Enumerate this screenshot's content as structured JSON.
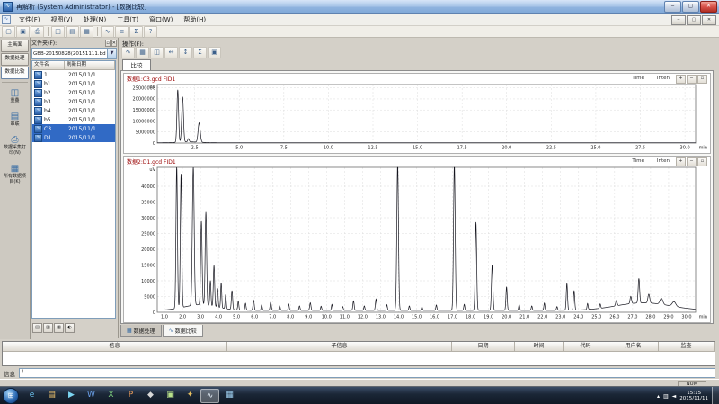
{
  "colors": {
    "selection": "#316ac5",
    "chart_title": "#990000",
    "titlebar": "#a9c6e8",
    "taskbar": "#1b2737"
  },
  "window": {
    "title": "再解析 (System Administrator) - [数据比较]",
    "controls": {
      "minimize": "‒",
      "maximize": "▢",
      "close": "✕"
    }
  },
  "menu": {
    "items": [
      "文件(F)",
      "视图(V)",
      "处理(M)",
      "工具(T)",
      "窗口(W)",
      "帮助(H)"
    ],
    "mdi_controls": [
      "‒",
      "▢",
      "✕"
    ]
  },
  "toolbar": {
    "icons": [
      {
        "name": "open-icon",
        "glyph": "▢"
      },
      {
        "name": "save-icon",
        "glyph": "▣"
      },
      {
        "name": "print-icon",
        "glyph": "⎙"
      },
      {
        "name": "sep",
        "glyph": ""
      },
      {
        "name": "overlay-view-icon",
        "glyph": "◫"
      },
      {
        "name": "tile-view-icon",
        "glyph": "▤"
      },
      {
        "name": "grid-view-icon",
        "glyph": "▦"
      },
      {
        "name": "sep",
        "glyph": ""
      },
      {
        "name": "chromatogram-icon",
        "glyph": "∿"
      },
      {
        "name": "list-icon",
        "glyph": "≡"
      },
      {
        "name": "calc-icon",
        "glyph": "Σ"
      },
      {
        "name": "help-icon",
        "glyph": "?"
      }
    ]
  },
  "sidebar": {
    "tabs": [
      {
        "label": "主画面",
        "active": false
      },
      {
        "label": "数据处理",
        "active": false
      },
      {
        "label": "数据比较",
        "active": true
      }
    ],
    "items": [
      {
        "name": "overlay",
        "label": "重叠",
        "glyph": "◫"
      },
      {
        "name": "series",
        "label": "串联",
        "glyph": "▤"
      },
      {
        "name": "report-print",
        "label": "数据采集打印(N)",
        "glyph": "⎙"
      },
      {
        "name": "all-data-items",
        "label": "所有数据项目(K)",
        "glyph": "▦"
      }
    ]
  },
  "file_panel": {
    "folder_label": "文件夹(F):",
    "folder_value": "GBB-20150828(20151111.bd",
    "header_buttons": [
      {
        "name": "pin-icon",
        "glyph": "▫"
      },
      {
        "name": "close-icon",
        "glyph": "✕"
      }
    ],
    "columns": [
      "文件名",
      "刷新日期"
    ],
    "files": [
      {
        "name": "1",
        "date": "2015/11/1",
        "selected": false
      },
      {
        "name": "b1",
        "date": "2015/11/1",
        "selected": false
      },
      {
        "name": "b2",
        "date": "2015/11/1",
        "selected": false
      },
      {
        "name": "b3",
        "date": "2015/11/1",
        "selected": false
      },
      {
        "name": "b4",
        "date": "2015/11/1",
        "selected": false
      },
      {
        "name": "b5",
        "date": "2015/11/1",
        "selected": false
      },
      {
        "name": "C3",
        "date": "2015/11/1",
        "selected": true
      },
      {
        "name": "D1",
        "date": "2015/11/1",
        "selected": true
      }
    ],
    "footer_icons": [
      {
        "name": "list-view-icon",
        "glyph": "▤"
      },
      {
        "name": "detail-view-icon",
        "glyph": "▥"
      },
      {
        "name": "thumb-view-icon",
        "glyph": "▦"
      },
      {
        "name": "refresh-icon",
        "glyph": "◐"
      }
    ]
  },
  "main": {
    "operation_label": "操作(F):",
    "op_icons": [
      {
        "name": "op-chromatogram-icon",
        "glyph": "∿"
      },
      {
        "name": "op-grid-icon",
        "glyph": "▦"
      },
      {
        "name": "op-overlay-icon",
        "glyph": "◫"
      },
      {
        "name": "op-stretch-x-icon",
        "glyph": "↔"
      },
      {
        "name": "op-stretch-y-icon",
        "glyph": "↕"
      },
      {
        "name": "op-calc-icon",
        "glyph": "Σ"
      },
      {
        "name": "op-save-icon",
        "glyph": "▣"
      }
    ],
    "compare_tab": "比较",
    "doc_tabs": [
      {
        "label": "数据处理",
        "glyph": "▦",
        "active": false
      },
      {
        "label": "数据比较",
        "glyph": "∿",
        "active": true
      }
    ]
  },
  "chart_tools": [
    {
      "name": "zoom-in-icon",
      "glyph": "+"
    },
    {
      "name": "zoom-out-icon",
      "glyph": "−"
    },
    {
      "name": "reset-zoom-icon",
      "glyph": "▫"
    }
  ],
  "chart_data": [
    {
      "type": "line",
      "title": "数据1:C3.gcd FID1",
      "ylabel": "uV",
      "xlabel": "min",
      "legend": [
        "Time",
        "Inten"
      ],
      "xlim": [
        0.4,
        30.6
      ],
      "ylim": [
        0,
        26500000
      ],
      "xticks": [
        2.5,
        5.0,
        7.5,
        10.0,
        12.5,
        15.0,
        17.5,
        20.0,
        22.5,
        25.0,
        27.5,
        30.0
      ],
      "yticks": [
        0,
        5000000,
        10000000,
        15000000,
        20000000,
        25000000
      ],
      "grid": true,
      "baseline": 120000,
      "peaks": [
        [
          1.55,
          23800000,
          0.045
        ],
        [
          1.82,
          20500000,
          0.05
        ],
        [
          2.15,
          1500000,
          0.04
        ],
        [
          2.75,
          8800000,
          0.06
        ]
      ],
      "drift": [
        [
          2.2,
          400000,
          0.6
        ]
      ]
    },
    {
      "type": "line",
      "title": "数据2:D1.gcd FID1",
      "ylabel": "uV",
      "xlabel": "min",
      "legend": [
        "Time",
        "Inten"
      ],
      "xlim": [
        0.6,
        30.5
      ],
      "ylim": [
        0,
        46000
      ],
      "xticks": [
        1,
        2,
        3,
        4,
        5,
        6,
        7,
        8,
        9,
        10,
        11,
        12,
        13,
        14,
        15,
        16,
        17,
        18,
        19,
        20,
        21,
        22,
        23,
        24,
        25,
        26,
        27,
        28,
        29,
        30
      ],
      "yticks": [
        0,
        5000,
        10000,
        15000,
        20000,
        25000,
        30000,
        35000,
        40000
      ],
      "grid": true,
      "baseline": 600,
      "peaks": [
        [
          1.68,
          45500,
          0.04
        ],
        [
          1.92,
          42500,
          0.04
        ],
        [
          2.6,
          44000,
          0.05
        ],
        [
          3.05,
          26500,
          0.04
        ],
        [
          3.3,
          29500,
          0.04
        ],
        [
          3.55,
          8000,
          0.03
        ],
        [
          3.75,
          13000,
          0.035
        ],
        [
          3.95,
          6000,
          0.03
        ],
        [
          4.15,
          8000,
          0.03
        ],
        [
          4.4,
          4500,
          0.03
        ],
        [
          4.75,
          6000,
          0.035
        ],
        [
          5.1,
          2800,
          0.03
        ],
        [
          5.5,
          2200,
          0.03
        ],
        [
          5.95,
          3200,
          0.035
        ],
        [
          6.4,
          1800,
          0.03
        ],
        [
          6.9,
          2600,
          0.035
        ],
        [
          7.4,
          1500,
          0.03
        ],
        [
          7.9,
          2000,
          0.03
        ],
        [
          8.5,
          1400,
          0.03
        ],
        [
          9.1,
          2400,
          0.035
        ],
        [
          9.7,
          1300,
          0.03
        ],
        [
          10.3,
          1900,
          0.03
        ],
        [
          10.9,
          1200,
          0.03
        ],
        [
          11.5,
          3000,
          0.035
        ],
        [
          12.1,
          1400,
          0.03
        ],
        [
          12.75,
          3600,
          0.035
        ],
        [
          13.35,
          1800,
          0.03
        ],
        [
          13.95,
          46500,
          0.045
        ],
        [
          14.6,
          1400,
          0.03
        ],
        [
          15.3,
          1100,
          0.03
        ],
        [
          16.1,
          1700,
          0.03
        ],
        [
          17.1,
          46500,
          0.045
        ],
        [
          17.65,
          1900,
          0.03
        ],
        [
          18.3,
          28000,
          0.04
        ],
        [
          19.2,
          14500,
          0.04
        ],
        [
          20.0,
          7500,
          0.035
        ],
        [
          20.7,
          1800,
          0.03
        ],
        [
          21.4,
          1400,
          0.03
        ],
        [
          22.1,
          2300,
          0.03
        ],
        [
          22.8,
          1200,
          0.03
        ],
        [
          23.35,
          8500,
          0.035
        ],
        [
          23.75,
          6200,
          0.035
        ],
        [
          24.5,
          1900,
          0.03
        ],
        [
          25.2,
          1400,
          0.03
        ],
        [
          26.1,
          1700,
          0.04
        ],
        [
          26.9,
          2300,
          0.04
        ],
        [
          27.35,
          7800,
          0.04
        ],
        [
          27.9,
          2800,
          0.05
        ],
        [
          28.6,
          1900,
          0.08
        ],
        [
          29.3,
          1500,
          0.1
        ]
      ],
      "drift": [
        [
          3.0,
          1800,
          0.9
        ],
        [
          27.6,
          2400,
          1.5
        ]
      ]
    }
  ],
  "audit_table": {
    "columns": [
      "信息",
      "子信息",
      "日期",
      "时间",
      "代码",
      "用户名",
      "监查"
    ],
    "rows": []
  },
  "info_bar": {
    "label": "信息",
    "value": "/"
  },
  "status_bar": {
    "num_label": "NUM"
  },
  "taskbar": {
    "start_glyph": "⊞",
    "icons": [
      {
        "name": "taskbar-app-browser",
        "glyph": "e",
        "color": "#6fc8f5"
      },
      {
        "name": "taskbar-app-folder",
        "glyph": "▤",
        "color": "#f0c36d"
      },
      {
        "name": "taskbar-app-media",
        "glyph": "▶",
        "color": "#7bd4f0"
      },
      {
        "name": "taskbar-app-word",
        "glyph": "W",
        "color": "#6a9fe8"
      },
      {
        "name": "taskbar-app-excel",
        "glyph": "X",
        "color": "#7ed07e"
      },
      {
        "name": "taskbar-app-ppt",
        "glyph": "P",
        "color": "#f2a05a"
      },
      {
        "name": "taskbar-app-1",
        "glyph": "◆",
        "color": "#d8d8d8"
      },
      {
        "name": "taskbar-app-2",
        "glyph": "▣",
        "color": "#b8e08a"
      },
      {
        "name": "taskbar-app-3",
        "glyph": "✦",
        "color": "#e8c060"
      },
      {
        "name": "taskbar-app-gcsolution",
        "glyph": "∿",
        "color": "#e6f1fb",
        "active": true
      },
      {
        "name": "taskbar-app-4",
        "glyph": "▦",
        "color": "#9fd0f0"
      }
    ],
    "tray_icons": [
      {
        "name": "hidden-icons-icon",
        "glyph": "▴"
      },
      {
        "name": "network-icon",
        "glyph": "▥"
      },
      {
        "name": "volume-icon",
        "glyph": "◄"
      }
    ],
    "clock": {
      "time": "15:15",
      "date": "2015/11/11"
    }
  }
}
